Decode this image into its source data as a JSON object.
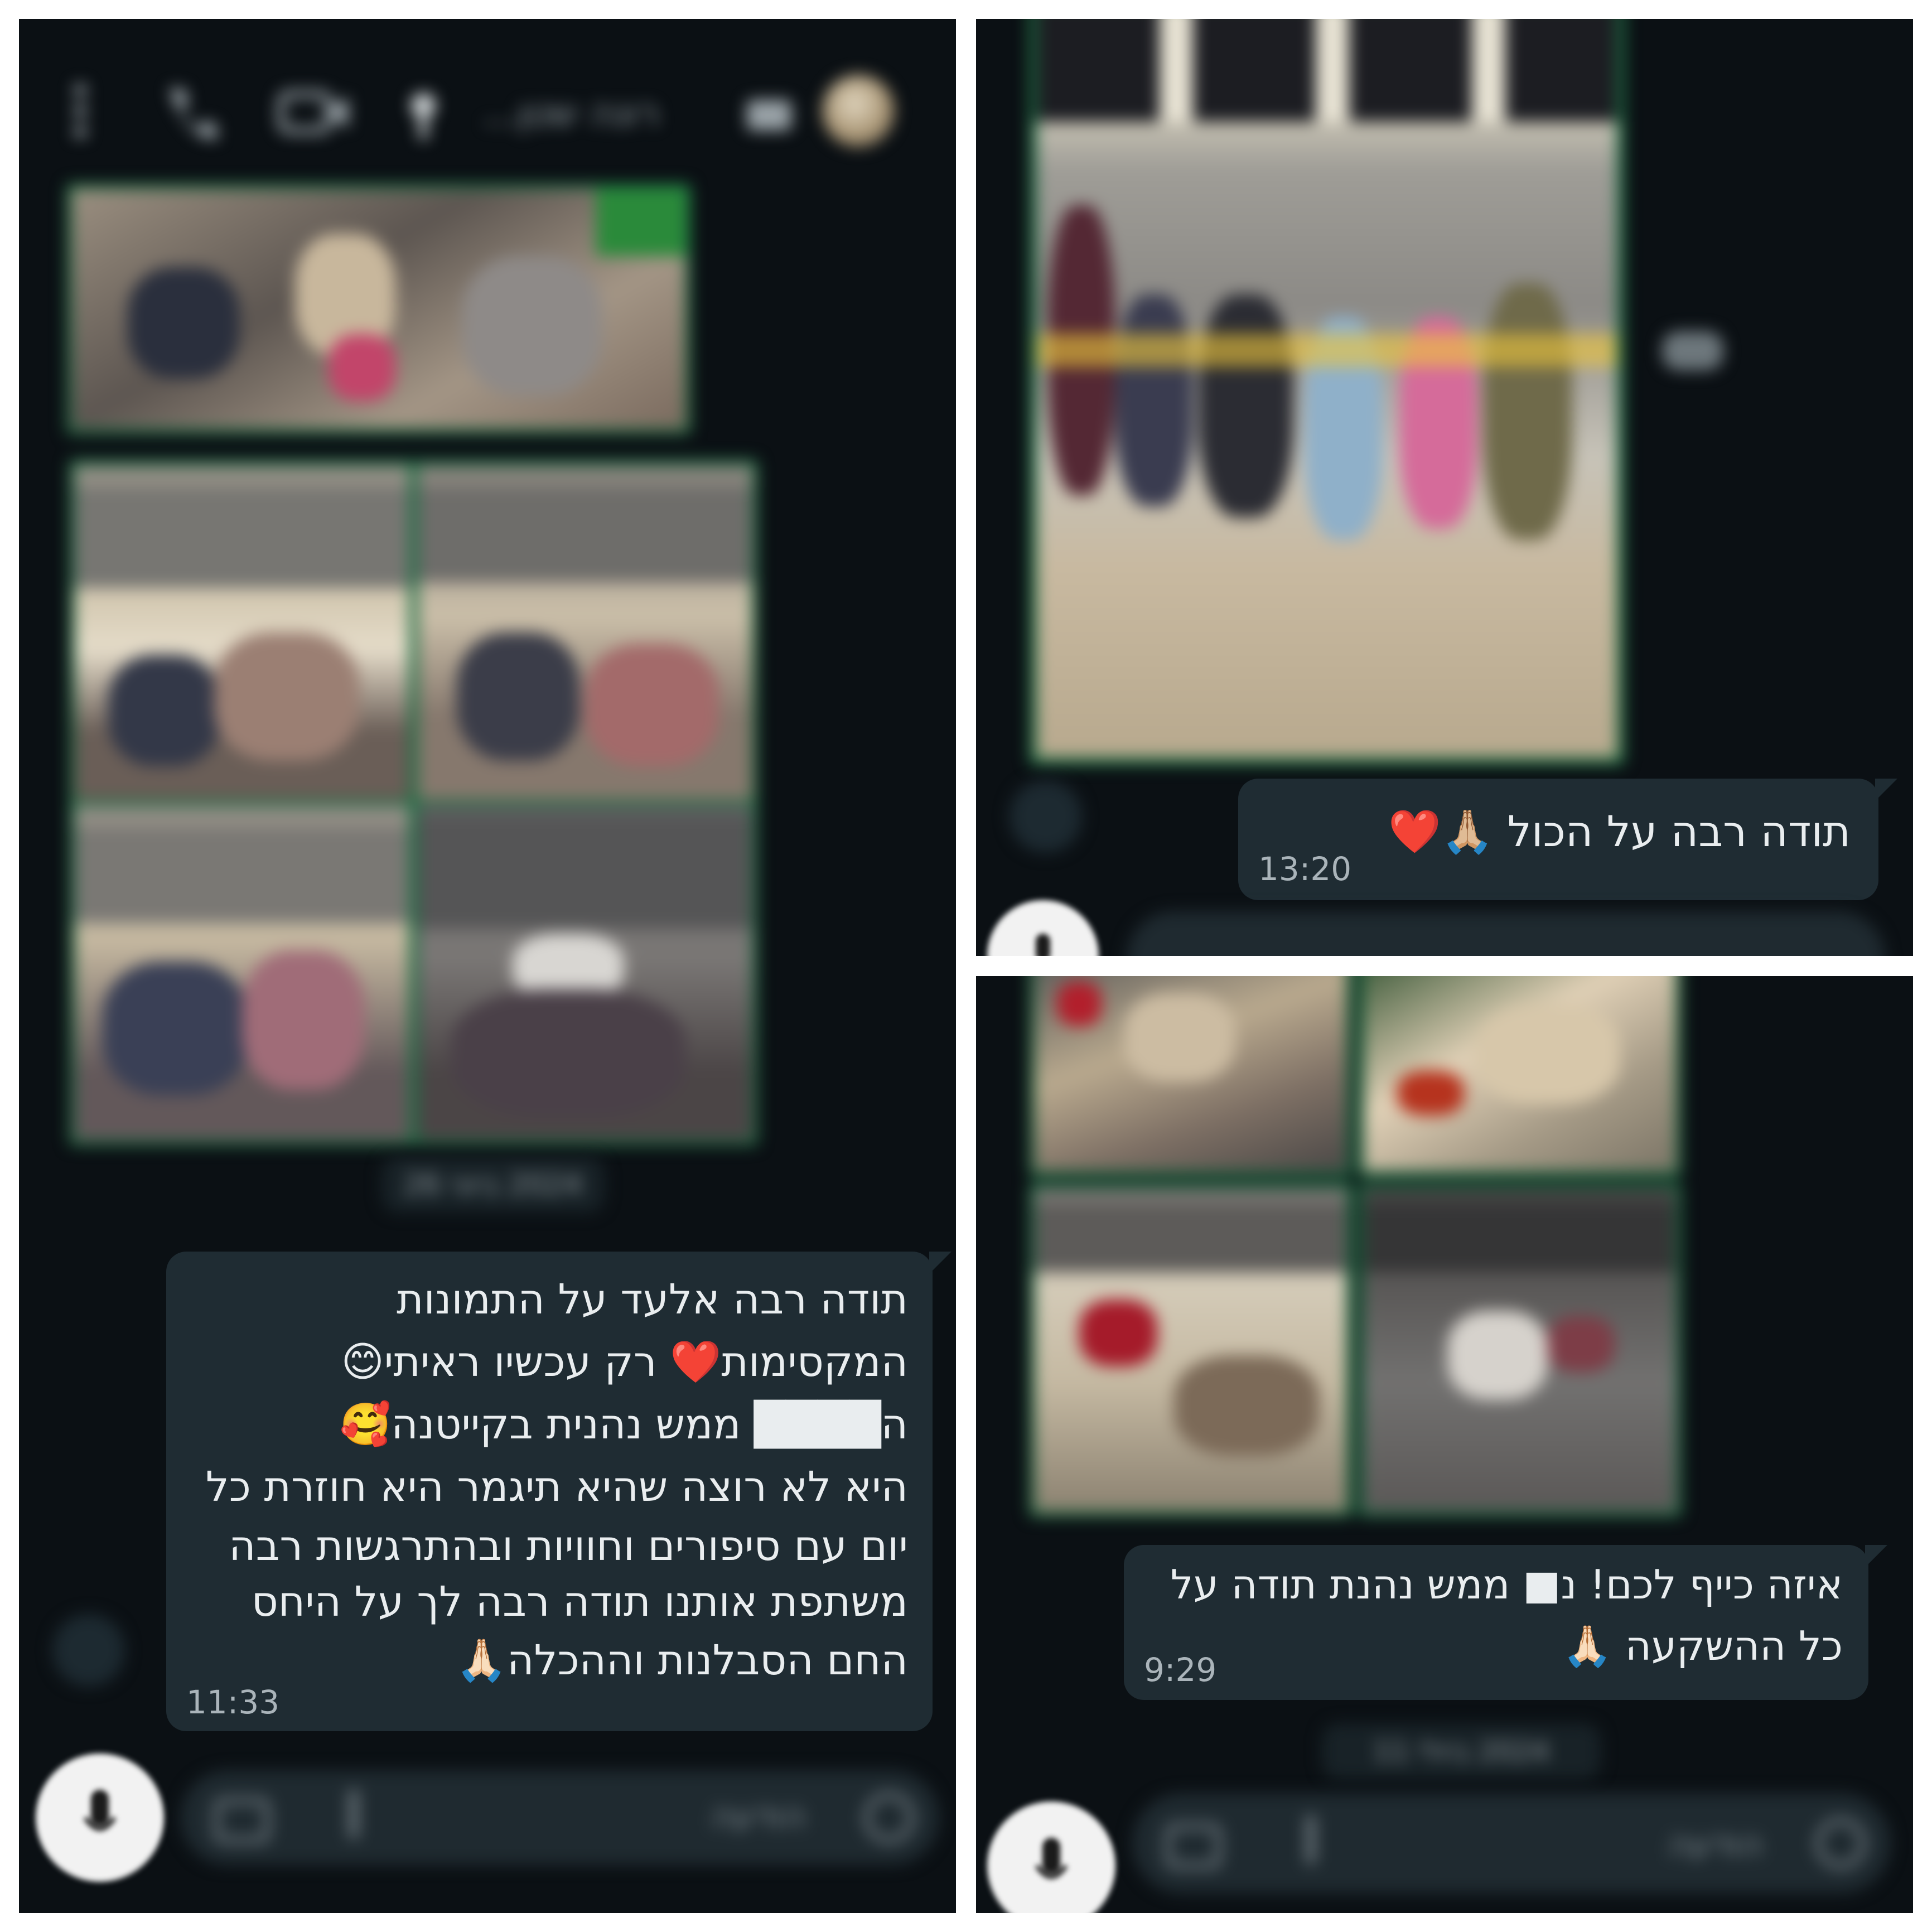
{
  "left": {
    "header": {
      "contact_name": "רונה שטן..."
    },
    "date_chip": "2024 ביוני 26",
    "message": {
      "lines": [
        "תודה רבה אלעד על התמונות",
        "המקסימות❤️ רק עכשיו ראיתי😊",
        "ה████ ממש נהנית בקייטנה🥰",
        "היא לא רוצה שהיא תיגמר היא חוזרת כל",
        "יום עם סיפורים וחוויות ובהתרגשות רבה",
        "משתפת אותנו תודה רבה לך על היחס",
        "החם הסבלנות וההכלה🙏🏻"
      ],
      "time": "11:33"
    },
    "input_placeholder": "הודעה"
  },
  "top_right": {
    "message": {
      "text": "תודה רבה על הכול 🙏🏼❤️",
      "time": "13:20"
    }
  },
  "bottom_right": {
    "message": {
      "lines": [
        "איזה כייף לכם! נ■ ממש נהנת תודה על",
        "כל ההשקעה 🙏🏻"
      ],
      "time": "9:29"
    },
    "date_chip": "2024 ביולי 11",
    "input_placeholder": "הודעה"
  },
  "colors": {
    "background": "#0b1014",
    "bubble": "#1f2c33",
    "photo_border": "#1f6f45",
    "divider": "#ffffff"
  },
  "icons": [
    "menu-dots-icon",
    "phone-icon",
    "video-call-icon",
    "pin-icon",
    "chat-icon",
    "mic-icon",
    "camera-icon",
    "attach-icon",
    "emoji-icon",
    "forward-icon"
  ]
}
